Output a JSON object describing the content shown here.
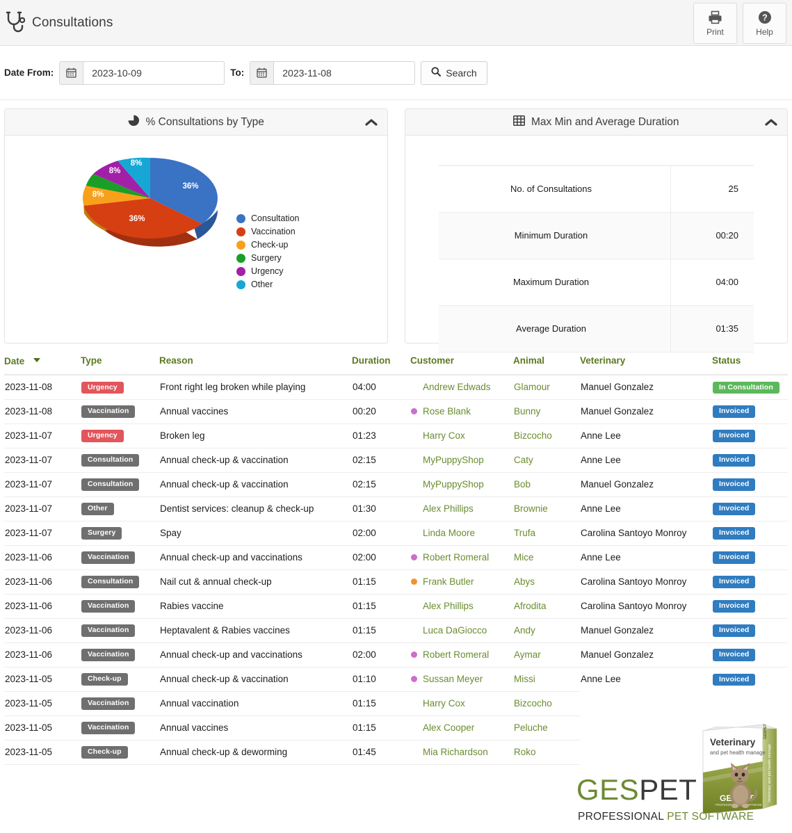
{
  "header": {
    "title": "Consultations",
    "icon": "stethoscope-icon",
    "actions": [
      {
        "label": "Print",
        "icon": "printer-icon"
      },
      {
        "label": "Help",
        "icon": "question-circle-icon"
      }
    ]
  },
  "filters": {
    "date_from_label": "Date From:",
    "date_from_value": "2023-10-09",
    "date_to_label": "To:",
    "date_to_value": "2023-11-08",
    "search_label": "Search",
    "calendar_icon": "calendar-icon",
    "search_icon": "search-icon"
  },
  "panels": {
    "left": {
      "title": "% Consultations by Type",
      "icon": "pie-chart-icon",
      "collapse_icon": "chevron-up-icon"
    },
    "right": {
      "title": "Max Min and Average Duration",
      "icon": "table-grid-icon",
      "collapse_icon": "chevron-up-icon",
      "rows": [
        {
          "label": "No. of Consultations",
          "value": "25"
        },
        {
          "label": "Minimum Duration",
          "value": "00:20"
        },
        {
          "label": "Maximum Duration",
          "value": "04:00"
        },
        {
          "label": "Average Duration",
          "value": "01:35"
        }
      ]
    }
  },
  "chart_data": {
    "type": "pie",
    "title": "% Consultations by Type",
    "categories": [
      "Consultation",
      "Vaccination",
      "Check-up",
      "Surgery",
      "Urgency",
      "Other"
    ],
    "values": [
      36,
      36,
      8,
      4,
      8,
      8
    ],
    "labels": [
      "36%",
      "36%",
      "8%",
      "",
      "8%",
      "8%"
    ],
    "colors": [
      "#3a72c4",
      "#d63f12",
      "#f9a01b",
      "#1b9e26",
      "#a21fa8",
      "#17a7d4"
    ],
    "legend_position": "right",
    "three_d": true
  },
  "table": {
    "columns": [
      {
        "key": "date",
        "label": "Date",
        "sorted": true,
        "sort_icon": "caret-down-icon"
      },
      {
        "key": "type",
        "label": "Type"
      },
      {
        "key": "reason",
        "label": "Reason"
      },
      {
        "key": "duration",
        "label": "Duration"
      },
      {
        "key": "customer",
        "label": "Customer"
      },
      {
        "key": "animal",
        "label": "Animal"
      },
      {
        "key": "veterinary",
        "label": "Veterinary"
      },
      {
        "key": "status",
        "label": "Status"
      }
    ],
    "rows": [
      {
        "date": "2023-11-08",
        "type": "Urgency",
        "type_style": "red",
        "reason": "Front right leg broken while playing",
        "duration": "04:00",
        "customer": "Andrew Edwads",
        "dot": null,
        "animal": "Glamour",
        "veterinary": "Manuel Gonzalez",
        "status": "In Consultation",
        "status_style": "green"
      },
      {
        "date": "2023-11-08",
        "type": "Vaccination",
        "type_style": "grey",
        "reason": "Annual vaccines",
        "duration": "00:20",
        "customer": "Rose Blank",
        "dot": "#cc6ecc",
        "animal": "Bunny",
        "veterinary": "Manuel Gonzalez",
        "status": "Invoiced",
        "status_style": "blue"
      },
      {
        "date": "2023-11-07",
        "type": "Urgency",
        "type_style": "red",
        "reason": "Broken leg",
        "duration": "01:23",
        "customer": "Harry Cox",
        "dot": null,
        "animal": "Bizcocho",
        "veterinary": "Anne Lee",
        "status": "Invoiced",
        "status_style": "blue"
      },
      {
        "date": "2023-11-07",
        "type": "Consultation",
        "type_style": "grey",
        "reason": "Annual check-up & vaccination",
        "duration": "02:15",
        "customer": "MyPuppyShop",
        "dot": null,
        "animal": "Caty",
        "veterinary": "Anne Lee",
        "status": "Invoiced",
        "status_style": "blue"
      },
      {
        "date": "2023-11-07",
        "type": "Consultation",
        "type_style": "grey",
        "reason": "Annual check-up & vaccination",
        "duration": "02:15",
        "customer": "MyPuppyShop",
        "dot": null,
        "animal": "Bob",
        "veterinary": "Manuel Gonzalez",
        "status": "Invoiced",
        "status_style": "blue"
      },
      {
        "date": "2023-11-07",
        "type": "Other",
        "type_style": "grey",
        "reason": "Dentist services: cleanup & check-up",
        "duration": "01:30",
        "customer": "Alex Phillips",
        "dot": null,
        "animal": "Brownie",
        "veterinary": "Anne Lee",
        "status": "Invoiced",
        "status_style": "blue"
      },
      {
        "date": "2023-11-07",
        "type": "Surgery",
        "type_style": "grey",
        "reason": "Spay",
        "duration": "02:00",
        "customer": "Linda Moore",
        "dot": null,
        "animal": "Trufa",
        "veterinary": "Carolina Santoyo Monroy",
        "status": "Invoiced",
        "status_style": "blue"
      },
      {
        "date": "2023-11-06",
        "type": "Vaccination",
        "type_style": "grey",
        "reason": "Annual check-up and vaccinations",
        "duration": "02:00",
        "customer": "Robert Romeral",
        "dot": "#cc6ecc",
        "animal": "Mice",
        "veterinary": "Anne Lee",
        "status": "Invoiced",
        "status_style": "blue"
      },
      {
        "date": "2023-11-06",
        "type": "Consultation",
        "type_style": "grey",
        "reason": "Nail cut & annual check-up",
        "duration": "01:15",
        "customer": "Frank Butler",
        "dot": "#f0922f",
        "animal": "Abys",
        "veterinary": "Carolina Santoyo Monroy",
        "status": "Invoiced",
        "status_style": "blue"
      },
      {
        "date": "2023-11-06",
        "type": "Vaccination",
        "type_style": "grey",
        "reason": "Rabies vaccine",
        "duration": "01:15",
        "customer": "Alex Phillips",
        "dot": null,
        "animal": "Afrodita",
        "veterinary": "Carolina Santoyo Monroy",
        "status": "Invoiced",
        "status_style": "blue"
      },
      {
        "date": "2023-11-06",
        "type": "Vaccination",
        "type_style": "grey",
        "reason": "Heptavalent & Rabies vaccines",
        "duration": "01:15",
        "customer": "Luca DaGiocco",
        "dot": null,
        "animal": "Andy",
        "veterinary": "Manuel Gonzalez",
        "status": "Invoiced",
        "status_style": "blue"
      },
      {
        "date": "2023-11-06",
        "type": "Vaccination",
        "type_style": "grey",
        "reason": "Annual check-up and vaccinations",
        "duration": "02:00",
        "customer": "Robert Romeral",
        "dot": "#cc6ecc",
        "animal": "Aymar",
        "veterinary": "Manuel Gonzalez",
        "status": "Invoiced",
        "status_style": "blue"
      },
      {
        "date": "2023-11-05",
        "type": "Check-up",
        "type_style": "grey",
        "reason": "Annual check-up & vaccination",
        "duration": "01:10",
        "customer": "Sussan Meyer",
        "dot": "#cc6ecc",
        "animal": "Missi",
        "veterinary": "Anne Lee",
        "status": "Invoiced",
        "status_style": "blue"
      },
      {
        "date": "2023-11-05",
        "type": "Vaccination",
        "type_style": "grey",
        "reason": "Annual vaccination",
        "duration": "01:15",
        "customer": "Harry Cox",
        "dot": null,
        "animal": "Bizcocho",
        "veterinary": "",
        "status": "",
        "status_style": "none"
      },
      {
        "date": "2023-11-05",
        "type": "Vaccination",
        "type_style": "grey",
        "reason": "Annual vaccines",
        "duration": "01:15",
        "customer": "Alex Cooper",
        "dot": null,
        "animal": "Peluche",
        "veterinary": "",
        "status": "",
        "status_style": "none"
      },
      {
        "date": "2023-11-05",
        "type": "Check-up",
        "type_style": "grey",
        "reason": "Annual check-up & deworming",
        "duration": "01:45",
        "customer": "Mia Richardson",
        "dot": null,
        "animal": "Roko",
        "veterinary": "",
        "status": "",
        "status_style": "none"
      }
    ]
  },
  "footer": {
    "brand_ges": "GES",
    "brand_pet": "PET",
    "tagline_a": "PROFESSIONAL ",
    "tagline_b": "PET SOFTWARE",
    "box_title": "Veterinary",
    "box_subtitle": "and pet health manage",
    "box_brand": "GESPET",
    "box_spine": "Veterinary and pet health manage"
  },
  "colors": {
    "accent_green": "#6a8c2f",
    "status_green": "#5cb85c",
    "status_blue": "#2f7cc0",
    "badge_red": "#e2555b",
    "badge_grey": "#6f6f6f"
  }
}
